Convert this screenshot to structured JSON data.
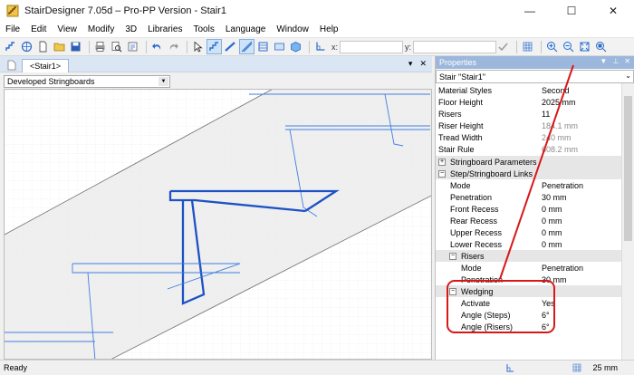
{
  "window": {
    "title": "StairDesigner 7.05d – Pro-PP Version - Stair1",
    "minimize": "—",
    "maximize": "☐",
    "close": "✕"
  },
  "menu": [
    "File",
    "Edit",
    "View",
    "Modify",
    "3D",
    "Libraries",
    "Tools",
    "Language",
    "Window",
    "Help"
  ],
  "toolbar": {
    "x_label": "x:",
    "y_label": "y:",
    "x_value": "",
    "y_value": ""
  },
  "tab": {
    "label": "<Stair1>",
    "pin": "▾",
    "close": "✕"
  },
  "view_select": {
    "value": "Developed Stringboards"
  },
  "properties": {
    "title": "Properties",
    "object": "Stair \"Stair1\"",
    "rows": [
      {
        "name": "Material Styles",
        "value": "Second"
      },
      {
        "name": "Floor Height",
        "value": "2025 mm"
      },
      {
        "name": "Risers",
        "value": "11"
      },
      {
        "name": "Riser Height",
        "value": "184.1 mm"
      },
      {
        "name": "Tread Width",
        "value": "240 mm"
      },
      {
        "name": "Stair Rule",
        "value": "608.2 mm"
      }
    ],
    "cat_stringboard": "Stringboard Parameters",
    "cat_links": "Step/Stringboard Links",
    "link_rows": [
      {
        "name": "Mode",
        "value": "Penetration"
      },
      {
        "name": "Penetration",
        "value": "30 mm"
      },
      {
        "name": "Front Recess",
        "value": "0 mm"
      },
      {
        "name": "Rear Recess",
        "value": "0 mm"
      },
      {
        "name": "Upper Recess",
        "value": "0 mm"
      },
      {
        "name": "Lower Recess",
        "value": "0 mm"
      }
    ],
    "cat_risers": "Risers",
    "riser_rows": [
      {
        "name": "Mode",
        "value": "Penetration"
      },
      {
        "name": "Penetration",
        "value": "30 mm"
      }
    ],
    "cat_wedging": "Wedging",
    "wedging_rows": [
      {
        "name": "Activate",
        "value": "Yes"
      },
      {
        "name": "Angle (Steps)",
        "value": "6°"
      },
      {
        "name": "Angle (Risers)",
        "value": "6°"
      }
    ]
  },
  "status": {
    "ready": "Ready",
    "units": "25 mm"
  },
  "colors": {
    "annotation": "#d81818",
    "drawing_blue": "#3f7fe0",
    "selected_blue": "#1c52c4"
  }
}
